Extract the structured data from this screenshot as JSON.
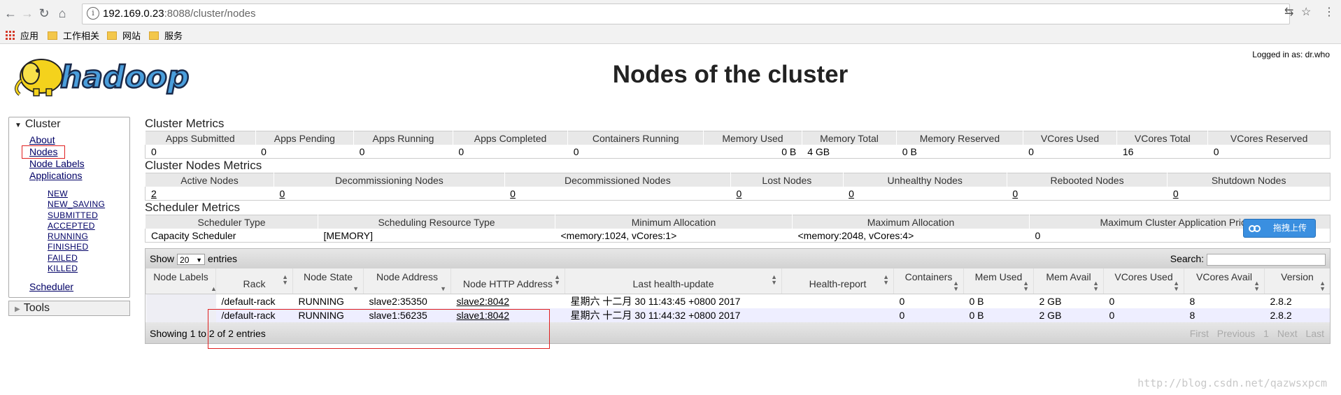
{
  "browser": {
    "url_host": "192.169.0.23",
    "url_rest": ":8088/cluster/nodes",
    "bookmarks": [
      "应用",
      "工作相关",
      "网站",
      "服务"
    ]
  },
  "header": {
    "logo_text": "hadoop",
    "title": "Nodes of the cluster",
    "logged_in": "Logged in as: dr.who"
  },
  "sidebar": {
    "cluster_label": "Cluster",
    "links": [
      "About",
      "Nodes",
      "Node Labels",
      "Applications"
    ],
    "app_states": [
      "NEW",
      "NEW_SAVING",
      "SUBMITTED",
      "ACCEPTED",
      "RUNNING",
      "FINISHED",
      "FAILED",
      "KILLED"
    ],
    "scheduler": "Scheduler",
    "tools_label": "Tools"
  },
  "cluster_metrics": {
    "title": "Cluster Metrics",
    "headers": [
      "Apps Submitted",
      "Apps Pending",
      "Apps Running",
      "Apps Completed",
      "Containers Running",
      "Memory Used",
      "Memory Total",
      "Memory Reserved",
      "VCores Used",
      "VCores Total",
      "VCores Reserved"
    ],
    "values": [
      "0",
      "0",
      "0",
      "0",
      "0",
      "0 B",
      "4 GB",
      "0 B",
      "0",
      "16",
      "0"
    ]
  },
  "node_metrics": {
    "title": "Cluster Nodes Metrics",
    "headers": [
      "Active Nodes",
      "Decommissioning Nodes",
      "Decommissioned Nodes",
      "Lost Nodes",
      "Unhealthy Nodes",
      "Rebooted Nodes",
      "Shutdown Nodes"
    ],
    "values": [
      "2",
      "0",
      "0",
      "0",
      "0",
      "0",
      "0"
    ]
  },
  "scheduler_metrics": {
    "title": "Scheduler Metrics",
    "headers": [
      "Scheduler Type",
      "Scheduling Resource Type",
      "Minimum Allocation",
      "Maximum Allocation",
      "Maximum Cluster Application Priority"
    ],
    "values": [
      "Capacity Scheduler",
      "[MEMORY]",
      "<memory:1024, vCores:1>",
      "<memory:2048, vCores:4>",
      "0"
    ]
  },
  "nodes_table": {
    "show_label": "Show",
    "entries_value": "20",
    "entries_label": "entries",
    "search_label": "Search:",
    "headers": [
      "Node Labels",
      "Rack",
      "Node State",
      "Node Address",
      "Node HTTP Address",
      "Last health-update",
      "Health-report",
      "Containers",
      "Mem Used",
      "Mem Avail",
      "VCores Used",
      "VCores Avail",
      "Version"
    ],
    "rows": [
      [
        "",
        "/default-rack",
        "RUNNING",
        "slave2:35350",
        "slave2:8042",
        "星期六 十二月 30 11:43:45 +0800 2017",
        "",
        "0",
        "0 B",
        "2 GB",
        "0",
        "8",
        "2.8.2"
      ],
      [
        "",
        "/default-rack",
        "RUNNING",
        "slave1:56235",
        "slave1:8042",
        "星期六 十二月 30 11:44:32 +0800 2017",
        "",
        "0",
        "0 B",
        "2 GB",
        "0",
        "8",
        "2.8.2"
      ]
    ],
    "footer_info": "Showing 1 to 2 of 2 entries",
    "pager": [
      "First",
      "Previous",
      "1",
      "Next",
      "Last"
    ]
  },
  "overlay": {
    "upload_label": "拖拽上传",
    "watermark": "http://blog.csdn.net/qazwsxpcm"
  }
}
